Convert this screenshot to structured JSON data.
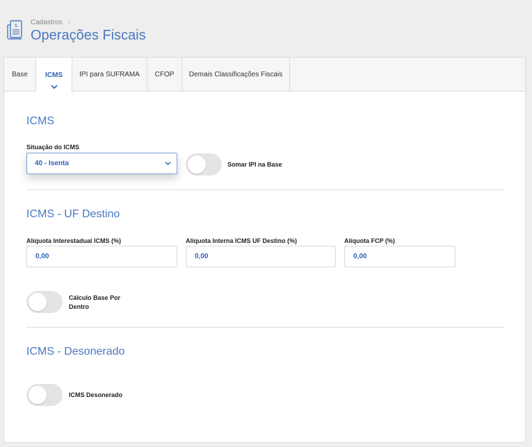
{
  "header": {
    "breadcrumb": "Cadastros",
    "title": "Operações Fiscais",
    "icon": "receipt-icon"
  },
  "tabs": [
    {
      "label": "Base"
    },
    {
      "label": "ICMS",
      "active": true
    },
    {
      "label": "IPI para SUFRAMA"
    },
    {
      "label": "CFOP"
    },
    {
      "label": "Demais Classificações Fiscais"
    }
  ],
  "icms": {
    "title": "ICMS",
    "situacao_label": "Situação do ICMS",
    "situacao_value": "40 - Isenta",
    "somar_ipi_label": "Somar IPI na Base",
    "somar_ipi_on": false
  },
  "uf_destino": {
    "title": "ICMS - UF Destino",
    "aliq_interestadual_label": "Alíquota Interestadual ICMS (%)",
    "aliq_interestadual_value": "0,00",
    "aliq_interna_label": "Alíquota Interna ICMS UF Destino (%)",
    "aliq_interna_value": "0,00",
    "aliq_fcp_label": "Alíquota FCP (%)",
    "aliq_fcp_value": "0,00",
    "calculo_base_label": "Cálculo Base Por Dentro",
    "calculo_base_on": false
  },
  "desonerado": {
    "title": "ICMS - Desonerado",
    "icms_desonerado_label": "ICMS Desonerado",
    "icms_desonerado_on": false
  },
  "colors": {
    "accent": "#4a78c2",
    "value_text": "#2e62b8",
    "toggle_off": "#e4e4e4"
  }
}
